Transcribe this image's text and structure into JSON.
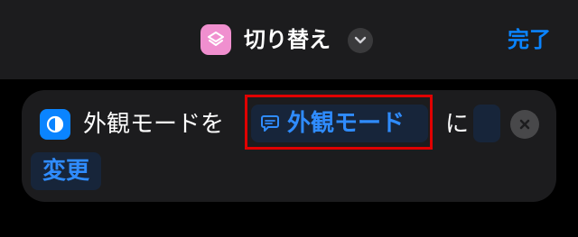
{
  "header": {
    "title": "切り替え",
    "done_label": "完了",
    "shortcut_icon": "layers-icon",
    "accent_color": "#0a84ff",
    "icon_color": "#f08fcf"
  },
  "action": {
    "icon": "appearance-icon",
    "text_before": "外観モードを",
    "variable_icon": "message-bubble-icon",
    "variable_label": "外観モード",
    "text_middle": "に",
    "operation": "変更"
  }
}
